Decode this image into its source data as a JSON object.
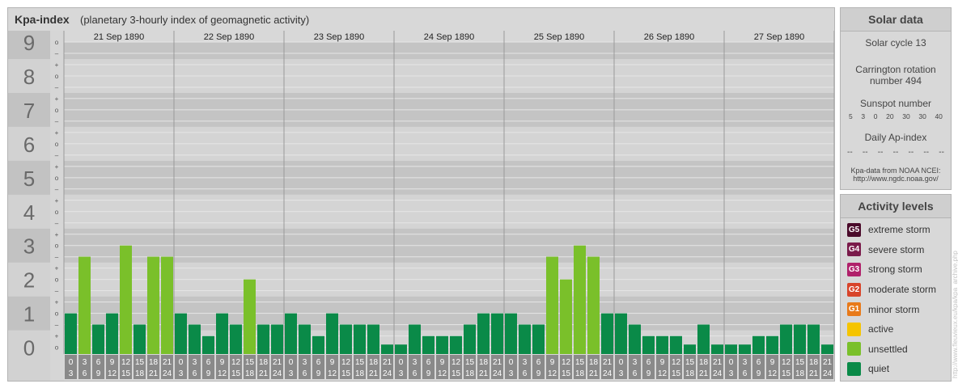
{
  "header": {
    "title": "Kpa-index",
    "subtitle": "(planetary 3-hourly index of geomagnetic activity)"
  },
  "chart_data": {
    "type": "bar",
    "title": "Kpa-index",
    "subtitle": "(planetary 3-hourly index of geomagnetic activity)",
    "ylim": [
      0,
      9
    ],
    "y_ticks": [
      "0",
      "1",
      "2",
      "3",
      "4",
      "5",
      "6",
      "7",
      "8",
      "9"
    ],
    "minor_ticks": [
      "o",
      "+",
      "–",
      "o",
      "+",
      "–",
      "o",
      "+",
      "–",
      "o",
      "+",
      "–",
      "o",
      "+",
      "–",
      "o",
      "+",
      "–",
      "o",
      "+",
      "–",
      "o",
      "+",
      "–",
      "o",
      "+",
      "–",
      "o"
    ],
    "days": [
      "21 Sep 1890",
      "22 Sep 1890",
      "23 Sep 1890",
      "24 Sep 1890",
      "25 Sep 1890",
      "26 Sep 1890",
      "27 Sep 1890"
    ],
    "interval_labels": [
      {
        "start": "0",
        "end": "3"
      },
      {
        "start": "3",
        "end": "6"
      },
      {
        "start": "6",
        "end": "9"
      },
      {
        "start": "9",
        "end": "12"
      },
      {
        "start": "12",
        "end": "15"
      },
      {
        "start": "15",
        "end": "18"
      },
      {
        "start": "18",
        "end": "21"
      },
      {
        "start": "21",
        "end": "24"
      }
    ],
    "values": [
      [
        1.0,
        2.67,
        0.67,
        1.0,
        3.0,
        0.67,
        2.67,
        2.67
      ],
      [
        1.0,
        0.67,
        0.33,
        1.0,
        0.67,
        2.0,
        0.67,
        0.67
      ],
      [
        1.0,
        0.67,
        0.33,
        1.0,
        0.67,
        0.67,
        0.67,
        0.0
      ],
      [
        0.0,
        0.67,
        0.33,
        0.33,
        0.33,
        0.67,
        1.0,
        1.0
      ],
      [
        1.0,
        0.67,
        0.67,
        2.67,
        2.0,
        3.0,
        2.67,
        1.0
      ],
      [
        1.0,
        0.67,
        0.33,
        0.33,
        0.33,
        0.0,
        0.67,
        0.0
      ],
      [
        0.0,
        0.0,
        0.33,
        0.33,
        0.67,
        0.67,
        0.67,
        0.0
      ]
    ],
    "grid": true,
    "colors": {
      "quiet": "#0a8a48",
      "unsettled": "#7ac02a",
      "bg_band_dark": "#c4c4c4",
      "bg_band_light": "#d4d4d4",
      "label_box": "#8a8a8a"
    }
  },
  "solar": {
    "heading": "Solar data",
    "cycle": "Solar cycle 13",
    "carrington_line1": "Carrington rotation",
    "carrington_line2": "number 494",
    "sunspot_heading": "Sunspot number",
    "sunspots": [
      "5",
      "3",
      "0",
      "20",
      "30",
      "30",
      "40"
    ],
    "ap_heading": "Daily Ap-index",
    "ap_values": [
      "--",
      "--",
      "--",
      "--",
      "--",
      "--",
      "--"
    ],
    "source_line1": "Kpa-data from NOAA NCEI:",
    "source_line2": "http://www.ngdc.noaa.gov/"
  },
  "activity": {
    "heading": "Activity levels",
    "levels": [
      {
        "code": "G5",
        "label": "extreme storm",
        "color": "#4a0a2a"
      },
      {
        "code": "G4",
        "label": "severe storm",
        "color": "#7a1a4a"
      },
      {
        "code": "G3",
        "label": "strong storm",
        "color": "#b0206a"
      },
      {
        "code": "G2",
        "label": "moderate storm",
        "color": "#d8442a"
      },
      {
        "code": "G1",
        "label": "minor storm",
        "color": "#e87a1a"
      },
      {
        "code": "",
        "label": "active",
        "color": "#f5c400"
      },
      {
        "code": "",
        "label": "unsettled",
        "color": "#7ac02a"
      },
      {
        "code": "",
        "label": "quiet",
        "color": "#0a8a48"
      }
    ]
  },
  "credit": "http://www.fleuvieux.eu/kpa/kpa_archive.php"
}
